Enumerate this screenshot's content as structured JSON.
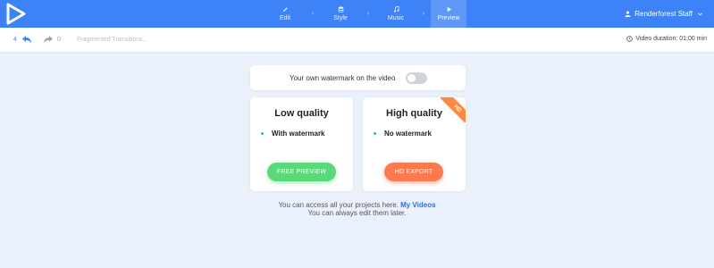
{
  "header": {
    "logo_icon": "play-logo-icon",
    "steps": [
      {
        "label": "Edit",
        "icon": "pencil-icon"
      },
      {
        "label": "Style",
        "icon": "layers-icon"
      },
      {
        "label": "Music",
        "icon": "music-note-icon"
      },
      {
        "label": "Preview",
        "icon": "play-icon",
        "active": true
      }
    ],
    "separator": "›",
    "user_name": "Renderforest Staff",
    "colors": {
      "bar": "#3e82f7",
      "active_step": "#5f97f8"
    }
  },
  "toolbar": {
    "undo_count": "4",
    "redo_count": "0",
    "project_title": "Fragmented Transitions...",
    "duration_label": "Video duration: 01:00 min"
  },
  "watermark": {
    "label": "Your own watermark on the video",
    "enabled": false
  },
  "options": {
    "low": {
      "title": "Low quality",
      "feature": "With watermark",
      "button": "FREE PREVIEW",
      "button_color": "#5bd97a"
    },
    "high": {
      "title": "High quality",
      "feature": "No watermark",
      "button": "HD EXPORT",
      "button_color": "#fd7a4f",
      "ribbon": "HD"
    }
  },
  "footer": {
    "text_before_link": "You can access all your projects here. ",
    "link_label": "My Videos",
    "line2": "You can always edit them later."
  }
}
